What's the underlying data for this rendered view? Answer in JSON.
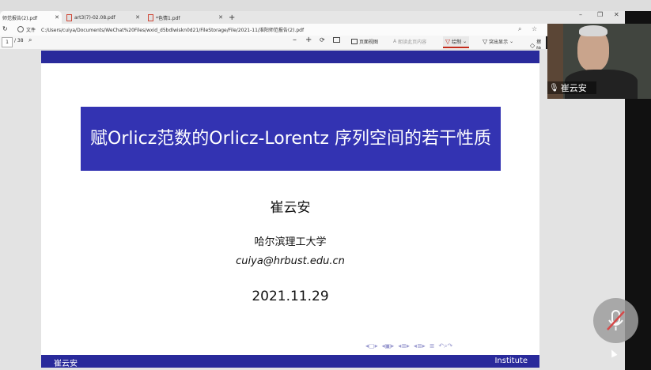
{
  "tabs": [
    {
      "label": "师范报告(2).pdf",
      "active": true
    },
    {
      "label": "art3(7)-02.08.pdf",
      "active": false
    },
    {
      "label": "*色情1.pdf",
      "active": false
    }
  ],
  "new_tab": "+",
  "window": {
    "minimize": "–",
    "restore": "❐",
    "close": "✕"
  },
  "address": {
    "file_label": "文件",
    "url": "C:/Users/cuiya/Documents/WeChat%20Files/wxid_d5bdlwiskn0d21/FileStorage/File/2021-11/淮阳师范报告(2).pdf"
  },
  "toolbar": {
    "page_current": "1",
    "page_total": "/ 38",
    "zoom_out": "–",
    "zoom_in": "+",
    "page_view": "页面视图",
    "read_aloud": "朗读此页内容",
    "draw": "绘制",
    "highlight": "突出显示",
    "erase": "擦除"
  },
  "slide": {
    "title": "赋Orlicz范数的Orlicz-Lorentz 序列空间的若干性质",
    "author": "崔云安",
    "affiliation": "哈尔滨理工大学",
    "email": "cuiya@hrbust.edu.cn",
    "date": "2021.11.29",
    "footer_left": "崔云安",
    "footer_right": "Institute"
  },
  "video": {
    "name": "崔云安"
  },
  "colors": {
    "beamer_dark": "#292a9b",
    "beamer_title": "#3333b2",
    "draw_accent": "#c42b1c"
  }
}
